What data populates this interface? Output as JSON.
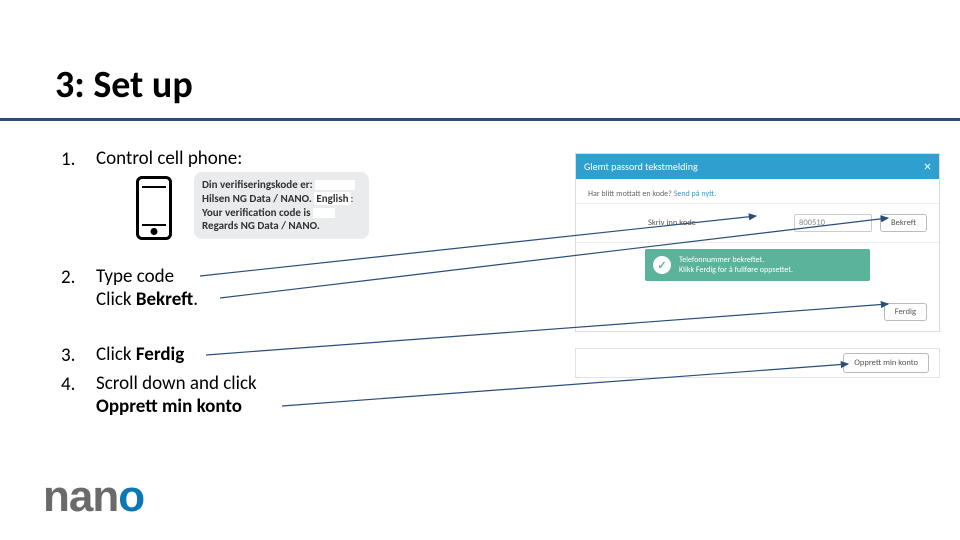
{
  "title": "3: Set up",
  "steps": {
    "s1": {
      "num": "1.",
      "text": "Control cell phone:"
    },
    "s2": {
      "num": "2.",
      "line1": "Type code",
      "line2a": "Click ",
      "line2b": "Bekreft",
      "line2c": "."
    },
    "s3": {
      "num": "3.",
      "line1a": "Click ",
      "line1b": "Ferdig"
    },
    "s4": {
      "num": "4.",
      "line1": "Scroll down and click",
      "line2": "Opprett min konto"
    }
  },
  "sms": {
    "l1a": "Din verifiseringskode er:",
    "l2a": "Hilsen NG Data / NANO. ",
    "en_label": "English",
    "l3": "Your verification code is",
    "l4": "Regards NG Data / NANO."
  },
  "dialog": {
    "header": "Glemt passord tekstmelding",
    "close": "×",
    "sent_prefix": "Har blitt mottatt en kode? ",
    "sent_link": "Send på nytt.",
    "code_label": "Skriv inn kode",
    "code_value": "800510",
    "bekreft": "Bekreft",
    "confirm_l1": "Telefonnummer bekreftet.",
    "confirm_l2": "Klikk Ferdig for å fullføre oppsettet.",
    "ferdig": "Ferdig"
  },
  "opprett": {
    "btn": "Opprett min konto"
  },
  "logo": {
    "n1": "n",
    "a1": "a",
    "n2": "n",
    "o": "o"
  }
}
